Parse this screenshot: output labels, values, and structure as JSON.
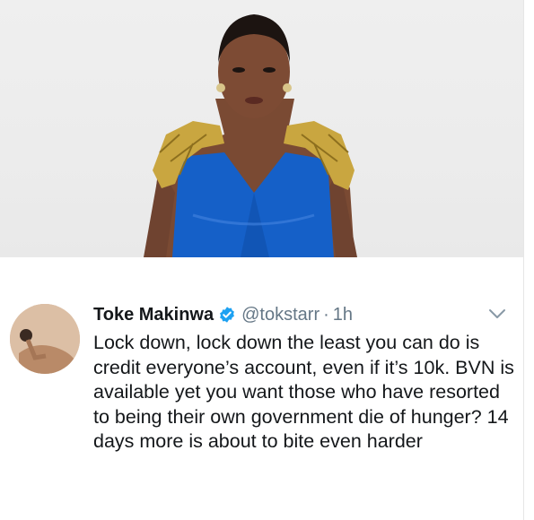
{
  "tweet": {
    "display_name": "Toke Makinwa",
    "handle": "@tokstarr",
    "separator": "·",
    "time": "1h",
    "text": "Lock down, lock down the least you can do is credit everyone’s account, even if it’s 10k. BVN is available yet you want those who have resorted to being their own government die of hunger? 14 days more is about to bite even harder"
  },
  "icons": {
    "verified": "verified-badge-icon",
    "caret": "chevron-down-icon"
  },
  "colors": {
    "verified_blue": "#1da1f2",
    "dress_blue": "#1560c8",
    "gold": "#c9a640",
    "muted_text": "#657786"
  }
}
